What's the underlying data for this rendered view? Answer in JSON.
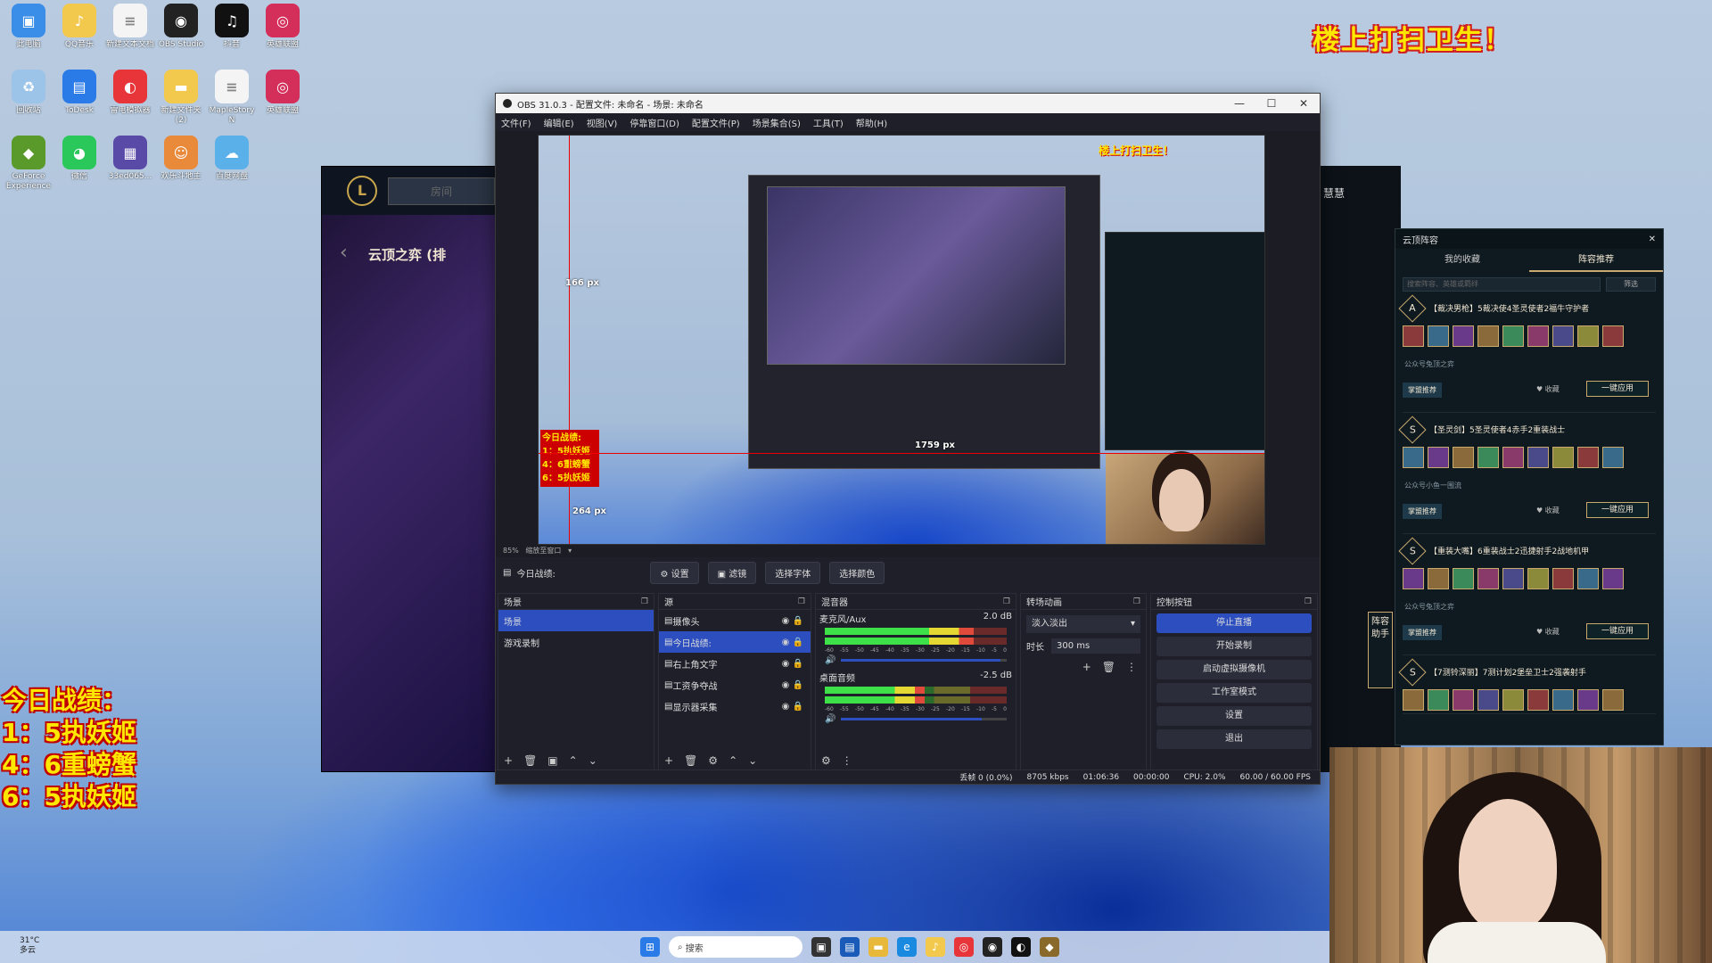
{
  "overlay": {
    "banner": "楼上打扫卫生！",
    "stats_title": "今日战绩：",
    "stats_lines": [
      "1：5执妖姬",
      "4：6重螃蟹",
      "6：5执妖姬"
    ]
  },
  "desktop_icons": [
    {
      "label": "此电脑",
      "icon": "computer-icon",
      "color": "#3a8ee8",
      "glyph": "▣"
    },
    {
      "label": "QQ音乐",
      "icon": "qq-music-icon",
      "color": "#f2c94c",
      "glyph": "♪"
    },
    {
      "label": "新建文本文档",
      "icon": "text-file-icon",
      "color": "#f4f4f4",
      "glyph": "≡"
    },
    {
      "label": "OBS Studio",
      "icon": "obs-icon",
      "color": "#222",
      "glyph": "◉"
    },
    {
      "label": "抖音",
      "icon": "douyin-icon",
      "color": "#111",
      "glyph": "♫"
    },
    {
      "label": "英雄联盟",
      "icon": "lol-icon",
      "color": "#d32f5a",
      "glyph": "◎"
    },
    {
      "label": "回收站",
      "icon": "recycle-bin-icon",
      "color": "#9bc4e8",
      "glyph": "♻"
    },
    {
      "label": "ToDesk",
      "icon": "todesk-icon",
      "color": "#2a7ae8",
      "glyph": "▤"
    },
    {
      "label": "雷电模拟器",
      "icon": "emulator-icon",
      "color": "#e8353a",
      "glyph": "◐"
    },
    {
      "label": "新建文件夹 (2)",
      "icon": "folder-icon",
      "color": "#f2c94c",
      "glyph": "▬"
    },
    {
      "label": "MapleStory N",
      "icon": "doc-icon",
      "color": "#f4f4f4",
      "glyph": "≡"
    },
    {
      "label": "英雄联盟",
      "icon": "lol-icon",
      "color": "#d32f5a",
      "glyph": "◎"
    },
    {
      "label": "GeForce Experience",
      "icon": "geforce-icon",
      "color": "#5a9a2a",
      "glyph": "◆"
    },
    {
      "label": "微信",
      "icon": "wechat-icon",
      "color": "#2ac85a",
      "glyph": "◕"
    },
    {
      "label": "33ed065...",
      "icon": "image-icon",
      "color": "#5a4aa8",
      "glyph": "▦"
    },
    {
      "label": "欢乐斗地主",
      "icon": "game-icon",
      "color": "#e88a3a",
      "glyph": "☺"
    },
    {
      "label": "百度网盘",
      "icon": "baidu-netdisk-icon",
      "color": "#5ab0e8",
      "glyph": "☁"
    }
  ],
  "obs": {
    "title": "OBS 31.0.3 - 配置文件: 未命名 - 场景: 未命名",
    "menu": [
      "文件(F)",
      "编辑(E)",
      "视图(V)",
      "停靠窗口(D)",
      "配置文件(P)",
      "场景集合(S)",
      "工具(T)",
      "帮助(H)"
    ],
    "zoom": "85%",
    "zoom_mode": "缩放至窗口",
    "selected_source_label": "今日战绩:",
    "source_bar_buttons": [
      "设置",
      "滤镜",
      "选择字体",
      "选择颜色"
    ],
    "preview": {
      "banner": "楼上打扫卫生！",
      "stats": [
        "今日战绩:",
        "1：5执妖姬",
        "4：6重螃蟹",
        "6：5执妖姬"
      ],
      "px_label_1": "1759 px",
      "px_label_2": "166 px",
      "px_label_3": "264 px"
    },
    "scenes": {
      "title": "场景",
      "items": [
        {
          "label": "场景",
          "selected": true
        },
        {
          "label": "游戏录制",
          "selected": false
        }
      ]
    },
    "sources": {
      "title": "源",
      "items": [
        {
          "label": "摄像头",
          "selected": false
        },
        {
          "label": "今日战绩:",
          "selected": true
        },
        {
          "label": "右上角文字",
          "selected": false
        },
        {
          "label": "工资争夺战",
          "selected": false
        },
        {
          "label": "显示器采集",
          "selected": false
        }
      ]
    },
    "mixer": {
      "title": "混音器",
      "channels": [
        {
          "name": "麦克风/Aux",
          "db": "2.0 dB",
          "level": 0.82,
          "volume": 0.96
        },
        {
          "name": "桌面音频",
          "db": "-2.5 dB",
          "level": 0.55,
          "volume": 0.85
        }
      ],
      "scale": [
        "-60",
        "-55",
        "-50",
        "-45",
        "-40",
        "-35",
        "-30",
        "-25",
        "-20",
        "-15",
        "-10",
        "-5",
        "0"
      ]
    },
    "transitions": {
      "title": "转场动画",
      "selected": "淡入淡出",
      "duration_label": "时长",
      "duration": "300 ms"
    },
    "controls": {
      "title": "控制按钮",
      "buttons": [
        "停止直播",
        "开始录制",
        "启动虚拟摄像机",
        "工作室模式",
        "设置",
        "退出"
      ]
    },
    "status": {
      "dropped": "丢帧 0 (0.0%)",
      "bitrate": "8705 kbps",
      "stream_time": "01:06:36",
      "record_time": "00:00:00",
      "cpu": "CPU: 2.0%",
      "fps": "60.00 / 60.00 FPS"
    }
  },
  "lol_client": {
    "room_label": "房间",
    "mode_title": "云顶之弈 (排"
  },
  "right_panel": {
    "name": "慧慧",
    "window_title": "云顶阵容",
    "tabs": [
      "我的收藏",
      "阵容推荐"
    ],
    "search_placeholder": "搜索阵容、英雄或羁绊",
    "filter_label": "筛选",
    "side_helper": "阵容助手",
    "comps": [
      {
        "tier": "A",
        "name": "【裁决男枪】5裁决使4圣灵使者2福牛守护者",
        "author": "公众号兔顶之弈",
        "tag": "掌盟推荐",
        "fav": "收藏",
        "apply": "一键应用"
      },
      {
        "tier": "S",
        "name": "【圣灵剑】5圣灵使者4赤手2重装战士",
        "author": "公众号小鱼一围流",
        "tag": "掌盟推荐",
        "fav": "收藏",
        "apply": "一键应用"
      },
      {
        "tier": "S",
        "name": "【重装大嘴】6重装战士2迅捷射手2战地机甲",
        "author": "公众号兔顶之弈",
        "tag": "掌盟推荐",
        "fav": "收藏",
        "apply": "一键应用"
      },
      {
        "tier": "S",
        "name": "【7测铃深丽】7测计划2堡垒卫士2强袭射手",
        "author": "",
        "tag": "",
        "fav": "",
        "apply": ""
      }
    ]
  },
  "taskbar": {
    "weather_temp": "31°C",
    "weather_desc": "多云",
    "search_placeholder": "搜索"
  },
  "colors": {
    "obs_bg": "#1e1f29",
    "obs_accent": "#2c4ebf",
    "lol_gold": "#c8aa6e",
    "overlay_yellow": "#ffe800",
    "overlay_red": "#d02020"
  }
}
